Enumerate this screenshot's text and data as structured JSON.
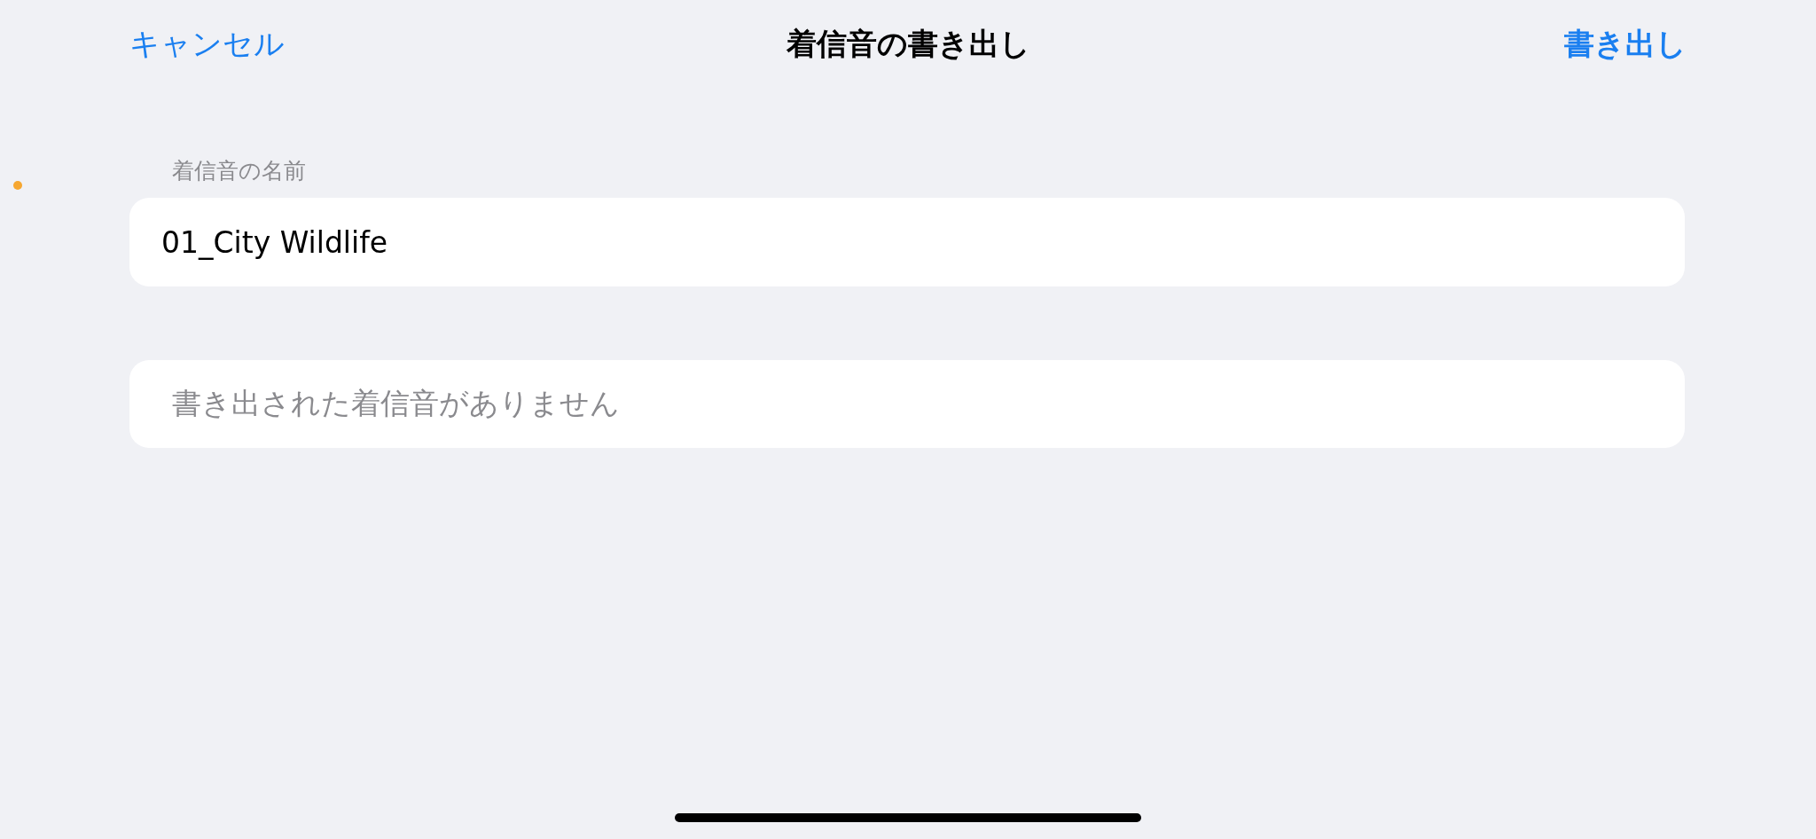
{
  "nav_bar": {
    "cancel": "キャンセル",
    "title": "着信音の書き出し",
    "export": "書き出し"
  },
  "name_field": {
    "label": "着信音の名前",
    "value": "01_City Wildlife"
  },
  "exported_list": {
    "empty_text": "書き出された着信音がありません"
  }
}
